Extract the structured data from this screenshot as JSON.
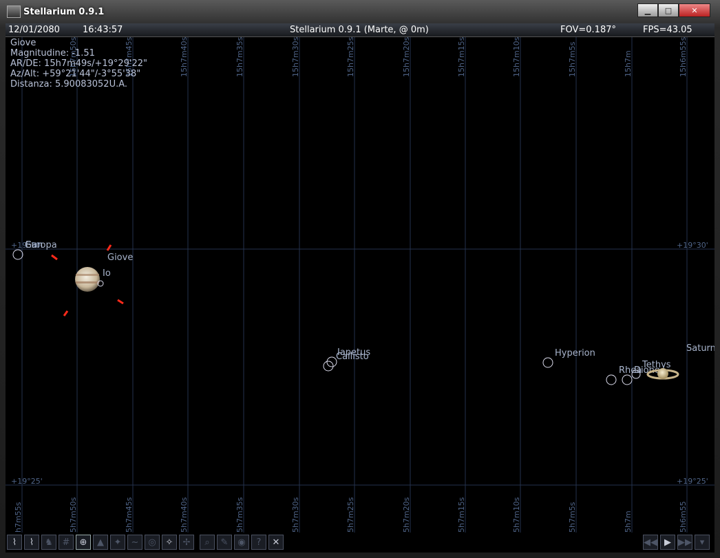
{
  "window": {
    "title": "Stellarium 0.9.1",
    "controls": [
      "▁",
      "□",
      "✕"
    ]
  },
  "topbar": {
    "date": "12/01/2080",
    "time": "16:43:57",
    "location": "Stellarium 0.9.1 (Marte,  @ 0m)",
    "fov": "FOV=0.187°",
    "fps": "FPS=43.05"
  },
  "info": {
    "name": "Giove",
    "magnitude": "Magnitudine: -1.51",
    "ra_de": "AR/DE: 15h7m49s/+19°29'22\"",
    "az_alt": "Az/Alt: +59°21'44\"/-3°55'38\"",
    "distance": "Distanza: 5.90083052U.A."
  },
  "grid": {
    "ra_top": [
      "15h7m50s",
      "15h7m45s",
      "15h7m40s",
      "15h7m35s",
      "15h7m30s",
      "15h7m25s",
      "15h7m20s",
      "15h7m15s",
      "15h7m10s",
      "15h7m5s",
      "15h7m",
      "15h6m55s"
    ],
    "ra_bottom": [
      "5h7m55s",
      "15h7m50s",
      "15h7m45s",
      "15h7m40s",
      "15h7m35s",
      "15h7m30s",
      "15h7m25s",
      "15h7m20s",
      "15h7m15s",
      "15h7m10s",
      "15h7m5s",
      "15h7m",
      "15h6m55"
    ],
    "dec_upper_left": "+19°30'",
    "dec_upper_right": "+19°30'",
    "dec_lower_left": "+19°25'",
    "dec_lower_right": "+19°25'"
  },
  "objects": {
    "europa": "Europa",
    "ganymede_partial": "Gan",
    "giove": "Giove",
    "io": "Io",
    "iapetus": "Iapetus",
    "callisto": "Callisto",
    "hyperion": "Hyperion",
    "rhea": "Rhea",
    "dione": "Dione",
    "tethys": "Tethys",
    "saturn": "Saturn"
  },
  "colors": {
    "grid": "#24324e",
    "label": "#a8b4cc",
    "marker": "#ff2a1a",
    "background": "#000000"
  },
  "toolbar_icons": [
    "constellation-lines-icon",
    "constellation-names-icon",
    "constellation-art-icon",
    "equatorial-grid-icon",
    "azimuthal-grid-icon",
    "ground-icon",
    "cardinal-points-icon",
    "atmosphere-icon",
    "nebulae-icon",
    "planets-icon",
    "equatorial-mount-icon",
    "center-icon",
    "search-icon",
    "config-icon",
    "view-icon",
    "help-icon",
    "quit-icon"
  ],
  "time_controls": [
    "rewind-icon",
    "play-icon",
    "fast-forward-icon",
    "menu-icon"
  ]
}
